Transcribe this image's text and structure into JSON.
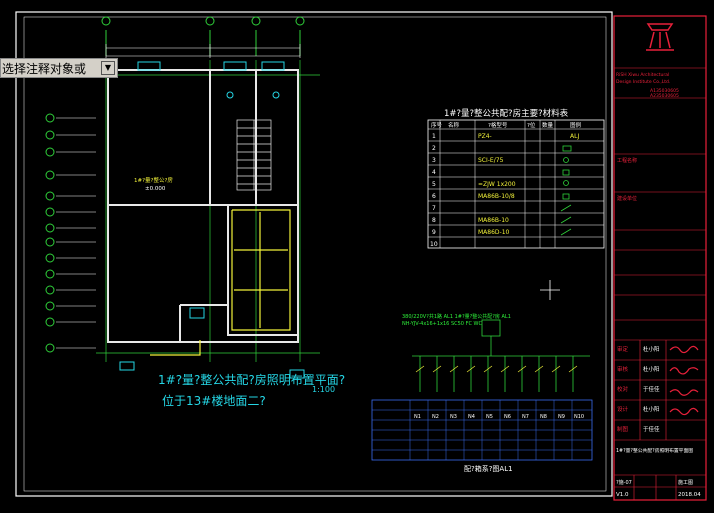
{
  "tooltip": {
    "text": "选择注释对象或",
    "dropdown_icon": "chevron-down-icon"
  },
  "plan": {
    "title_line1": "1#?量?整公共配?房照明布置平面?",
    "scale": "1:100",
    "title_line2": "位于13#楼地面二?",
    "room_label": "1#?量?整公?房",
    "elevation": "±0.000"
  },
  "materials_table": {
    "title": "1#?量?整公共配?房主要?材料表",
    "headers": [
      "序号",
      "名称",
      "?格型号",
      "?位",
      "数量",
      "图例"
    ],
    "rows": [
      {
        "no": "1",
        "model": "PZ4-",
        "legend": "ALJ"
      },
      {
        "no": "2",
        "model": "",
        "legend": ""
      },
      {
        "no": "3",
        "model": "SCI-E/75",
        "legend": ""
      },
      {
        "no": "4",
        "model": "",
        "legend": ""
      },
      {
        "no": "5",
        "model": "=ZJW 1x200",
        "legend": ""
      },
      {
        "no": "6",
        "model": "MA86B-10/8",
        "legend": ""
      },
      {
        "no": "7",
        "model": "",
        "legend": ""
      },
      {
        "no": "8",
        "model": "MA86B-10",
        "legend": ""
      },
      {
        "no": "9",
        "model": "MA86D-10",
        "legend": ""
      },
      {
        "no": "10",
        "model": "",
        "legend": ""
      }
    ]
  },
  "distribution": {
    "header": "380/220V?共1路 AL1 1#?量?整公共配?房 AL1",
    "subheader": "NH-YJV-4x16+1x16 SC50 FC WC",
    "caption": "配?箱系?图AL1",
    "schedule_cols": [
      "N1",
      "N2",
      "N3",
      "N4",
      "N5",
      "N6",
      "N7",
      "N8",
      "N9",
      "N10"
    ]
  },
  "title_block": {
    "company_en1": "RiSH Xiwu Architectural",
    "company_en2": "Design Institute Co.,Ltd.",
    "cert1": "A135030605",
    "cert2": "A235030605",
    "roles": [
      "审定",
      "审核",
      "校对",
      "设计",
      "制图"
    ],
    "names": [
      "杜小阳",
      "杜小阳",
      "于佳佳",
      "杜小阳",
      "于佳佳"
    ],
    "project_label": "工程名称",
    "owner_label": "建设单位",
    "drawing_title": "1#?量?整公共配?房照明布置平面图",
    "drawing_no": "?施-07",
    "version": "V1.0",
    "date": "2018.04",
    "phase": "施工图"
  },
  "colors": {
    "background": "#000000",
    "title_frame": "#e8203a",
    "drawing_frame": "#ffffff",
    "wall": "#e8e8e8",
    "grid": "#2fd13a",
    "wiring": "#f2f23a",
    "table_lines": "#ffffff",
    "schedule": "#3a6cf0",
    "text_green": "#2ef23a",
    "text_cyan": "#25d6e5"
  }
}
